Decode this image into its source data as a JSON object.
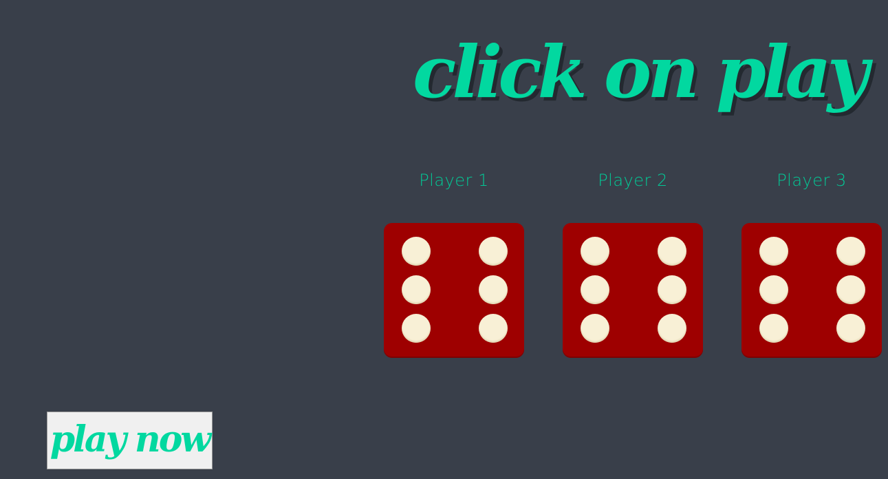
{
  "headline": "click on play",
  "players": [
    {
      "label": "Player 1",
      "die_value": 6
    },
    {
      "label": "Player 2",
      "die_value": 6
    },
    {
      "label": "Player 3",
      "die_value": 6
    }
  ],
  "play_button": {
    "label": "play now"
  },
  "colors": {
    "background": "#393f4a",
    "accent": "#02d8a0",
    "die_face": "#9e0000",
    "die_pip": "#f8f0d6"
  }
}
